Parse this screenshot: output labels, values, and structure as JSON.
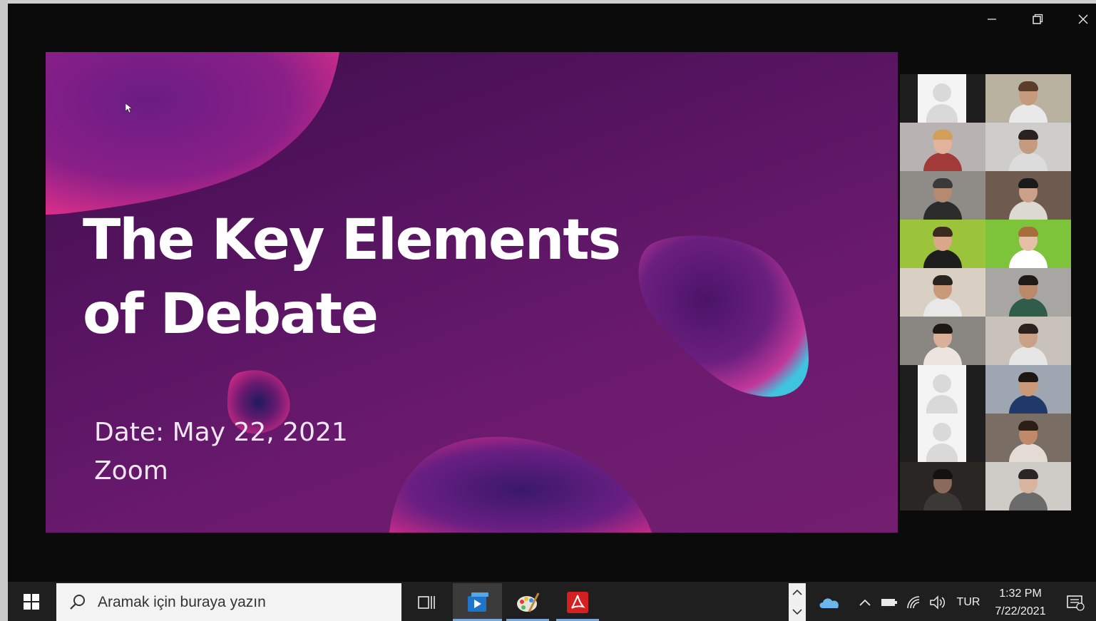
{
  "window": {
    "minimize_label": "Minimize",
    "restore_label": "Restore",
    "close_label": "Close"
  },
  "slide": {
    "title": "The Key Elements of Debate",
    "date_line": "Date: May 22, 2021",
    "venue_line": "Zoom"
  },
  "gallery": {
    "tiles": [
      {
        "type": "placeholder"
      },
      {
        "type": "video",
        "bg": "#b9b2a0",
        "skin": "#c69a7d",
        "shirt": "#e9e9ea",
        "hair": "#5a3d2a"
      },
      {
        "type": "video",
        "bg": "#b8b2b2",
        "skin": "#e2b49c",
        "shirt": "#a33a3a",
        "hair": "#d0a05a"
      },
      {
        "type": "video",
        "bg": "#cfcdc9",
        "skin": "#c49b80",
        "shirt": "#dcdcdc",
        "hair": "#2a2220"
      },
      {
        "type": "video",
        "bg": "#8f8c88",
        "skin": "#b58a70",
        "shirt": "#2c2c2c",
        "hair": "#3a3a3a"
      },
      {
        "type": "video",
        "bg": "#6e5a4e",
        "skin": "#caa08a",
        "shirt": "#dcd8d2",
        "hair": "#1a1a1a"
      },
      {
        "type": "video",
        "bg": "#9bc43a",
        "skin": "#d9a888",
        "shirt": "#1e1e1e",
        "hair": "#3a2a20"
      },
      {
        "type": "video",
        "bg": "#7dc43b",
        "skin": "#e5bfa6",
        "shirt": "#ffffff",
        "hair": "#a56e3a"
      },
      {
        "type": "video",
        "bg": "#d9cfc2",
        "skin": "#c89a7a",
        "shirt": "#e8e8e8",
        "hair": "#2a2420"
      },
      {
        "type": "video",
        "bg": "#a8a6a3",
        "skin": "#b98a6a",
        "shirt": "#2f5d4a",
        "hair": "#1e1a18"
      },
      {
        "type": "video",
        "bg": "#8a8783",
        "skin": "#d9b09a",
        "shirt": "#ece4de",
        "hair": "#1e1814"
      },
      {
        "type": "video",
        "bg": "#c9c2ba",
        "skin": "#caa186",
        "shirt": "#e6e6e6",
        "hair": "#2a221e"
      },
      {
        "type": "placeholder"
      },
      {
        "type": "video",
        "bg": "#9ea7b1",
        "skin": "#c9997a",
        "shirt": "#1f3a6a",
        "hair": "#1b1612"
      },
      {
        "type": "placeholder"
      },
      {
        "type": "video",
        "bg": "#7a6d64",
        "skin": "#c08a6a",
        "shirt": "#e4dcd4",
        "hair": "#2a1e16"
      },
      {
        "type": "video",
        "bg": "#2a2624",
        "skin": "#8a6a5a",
        "shirt": "#3c3835",
        "hair": "#141210"
      },
      {
        "type": "video",
        "bg": "#cfccc8",
        "skin": "#d8b49e",
        "shirt": "#6b6b6b",
        "hair": "#2a2623"
      }
    ]
  },
  "taskbar": {
    "search_placeholder": "Aramak için buraya yazın",
    "language": "TUR",
    "time": "1:32 PM",
    "date": "7/22/2021"
  },
  "colors": {
    "slide_bg": "#5a1662",
    "accent_pink": "#e0308a",
    "accent_cyan": "#3fc4e0",
    "taskbar": "#1f1f1f"
  }
}
